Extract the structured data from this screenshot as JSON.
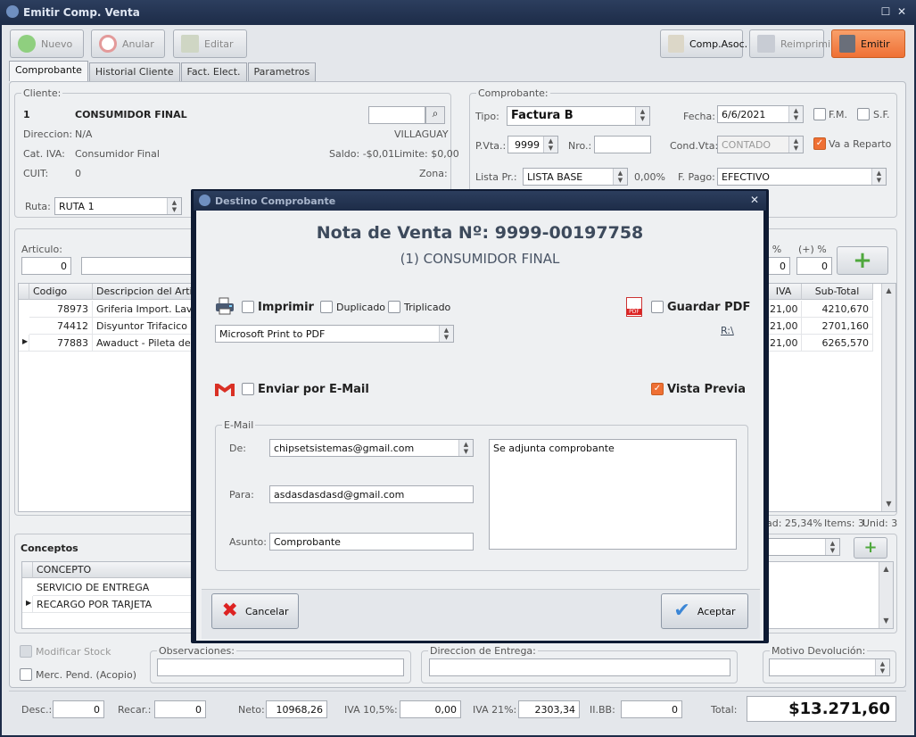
{
  "window": {
    "title": "Emitir Comp. Venta"
  },
  "toolbar": {
    "nuevo": "Nuevo",
    "anular": "Anular",
    "editar": "Editar",
    "comp_asoc": "Comp.Asoc.",
    "reimprimir": "Reimprimir",
    "emitir": "Emitir"
  },
  "tabs": [
    "Comprobante",
    "Historial Cliente",
    "Fact. Elect.",
    "Parametros"
  ],
  "cliente": {
    "group": "Cliente:",
    "codigo": "1",
    "nombre": "CONSUMIDOR FINAL",
    "direccion_label": "Direccion:",
    "direccion": "N/A",
    "localidad": "VILLAGUAY",
    "cativa_label": "Cat. IVA:",
    "cativa": "Consumidor Final",
    "saldo": "Saldo: -$0,01",
    "limite": "Limite: $0,00",
    "cuit_label": "CUIT:",
    "cuit": "0",
    "zona": "Zona:",
    "ruta_label": "Ruta:",
    "ruta": "RUTA 1"
  },
  "comprobante": {
    "group": "Comprobante:",
    "tipo_label": "Tipo:",
    "tipo": "Factura B",
    "fecha_label": "Fecha:",
    "fecha": "6/6/2021",
    "fm": "F.M.",
    "sf": "S.F.",
    "pvta_label": "P.Vta.:",
    "pvta": "9999",
    "nro_label": "Nro.:",
    "nro": "",
    "condvta_label": "Cond.Vta:",
    "condvta": "CONTADO",
    "reparto": "Va a Reparto",
    "listapr_label": "Lista Pr.:",
    "listapr": "LISTA BASE",
    "listapr_pct": "0,00%",
    "fpago_label": "F. Pago:",
    "fpago": "EFECTIVO"
  },
  "articulo": {
    "label": "Articulo:",
    "cantidad": "0",
    "desc_label": ") %",
    "desc_val": "0",
    "rec_label": "(+) %",
    "rec_val": "0"
  },
  "items_grid": {
    "headers": [
      "Codigo",
      "Descripcion del Articulo",
      "IVA",
      "Sub-Total"
    ],
    "rows": [
      {
        "codigo": "78973",
        "desc": "Griferia  Import. Lavat",
        "iva": "21,00",
        "subtotal": "4210,670"
      },
      {
        "codigo": "74412",
        "desc": "Disyuntor Trifacico 4 x",
        "iva": "21,00",
        "subtotal": "2701,160"
      },
      {
        "codigo": "77883",
        "desc": "Awaduct - Pileta dese",
        "iva": "21,00",
        "subtotal": "6265,570"
      }
    ],
    "summary_ad": "ad: 25,34%",
    "summary_items": "Items: 3",
    "summary_unid": "Unid: 3"
  },
  "conceptos": {
    "title": "Conceptos",
    "header": "CONCEPTO",
    "rows": [
      "SERVICIO DE ENTREGA",
      "RECARGO POR TARJETA"
    ]
  },
  "bottom": {
    "modificar_stock": "Modificar Stock",
    "merc_pend": "Merc. Pend. (Acopio)",
    "observaciones": "Observaciones:",
    "direccion_entrega": "Direccion de Entrega:",
    "motivo_devolucion": "Motivo Devolución:"
  },
  "totals": {
    "desc_label": "Desc.:",
    "desc": "0",
    "recar_label": "Recar.:",
    "recar": "0",
    "neto_label": "Neto:",
    "neto": "10968,26",
    "iva105_label": "IVA 10,5%:",
    "iva105": "0,00",
    "iva21_label": "IVA 21%:",
    "iva21": "2303,34",
    "iibb_label": "II.BB:",
    "iibb": "0",
    "total_label": "Total:",
    "total": "$13.271,60"
  },
  "modal": {
    "title": "Destino Comprobante",
    "heading": "Nota de Venta Nº: 9999-00197758",
    "subheading": "(1) CONSUMIDOR FINAL",
    "imprimir": "Imprimir",
    "duplicado": "Duplicado",
    "triplicado": "Triplicado",
    "printer": "Microsoft Print to PDF",
    "guardar_pdf": "Guardar PDF",
    "pdf_path": "R:\\",
    "enviar_email": "Enviar por E-Mail",
    "vista_previa": "Vista Previa",
    "email_group": "E-Mail",
    "de_label": "De:",
    "de": "chipsetsistemas@gmail.com",
    "para_label": "Para:",
    "para": "asdasdasdasd@gmail.com",
    "asunto_label": "Asunto:",
    "asunto": "Comprobante",
    "mensaje": "Se adjunta comprobante",
    "cancelar": "Cancelar",
    "aceptar": "Aceptar"
  },
  "colors": {
    "accent": "#ef7034",
    "titlebar": "#1d2c48",
    "heading": "#3d4a5c"
  }
}
